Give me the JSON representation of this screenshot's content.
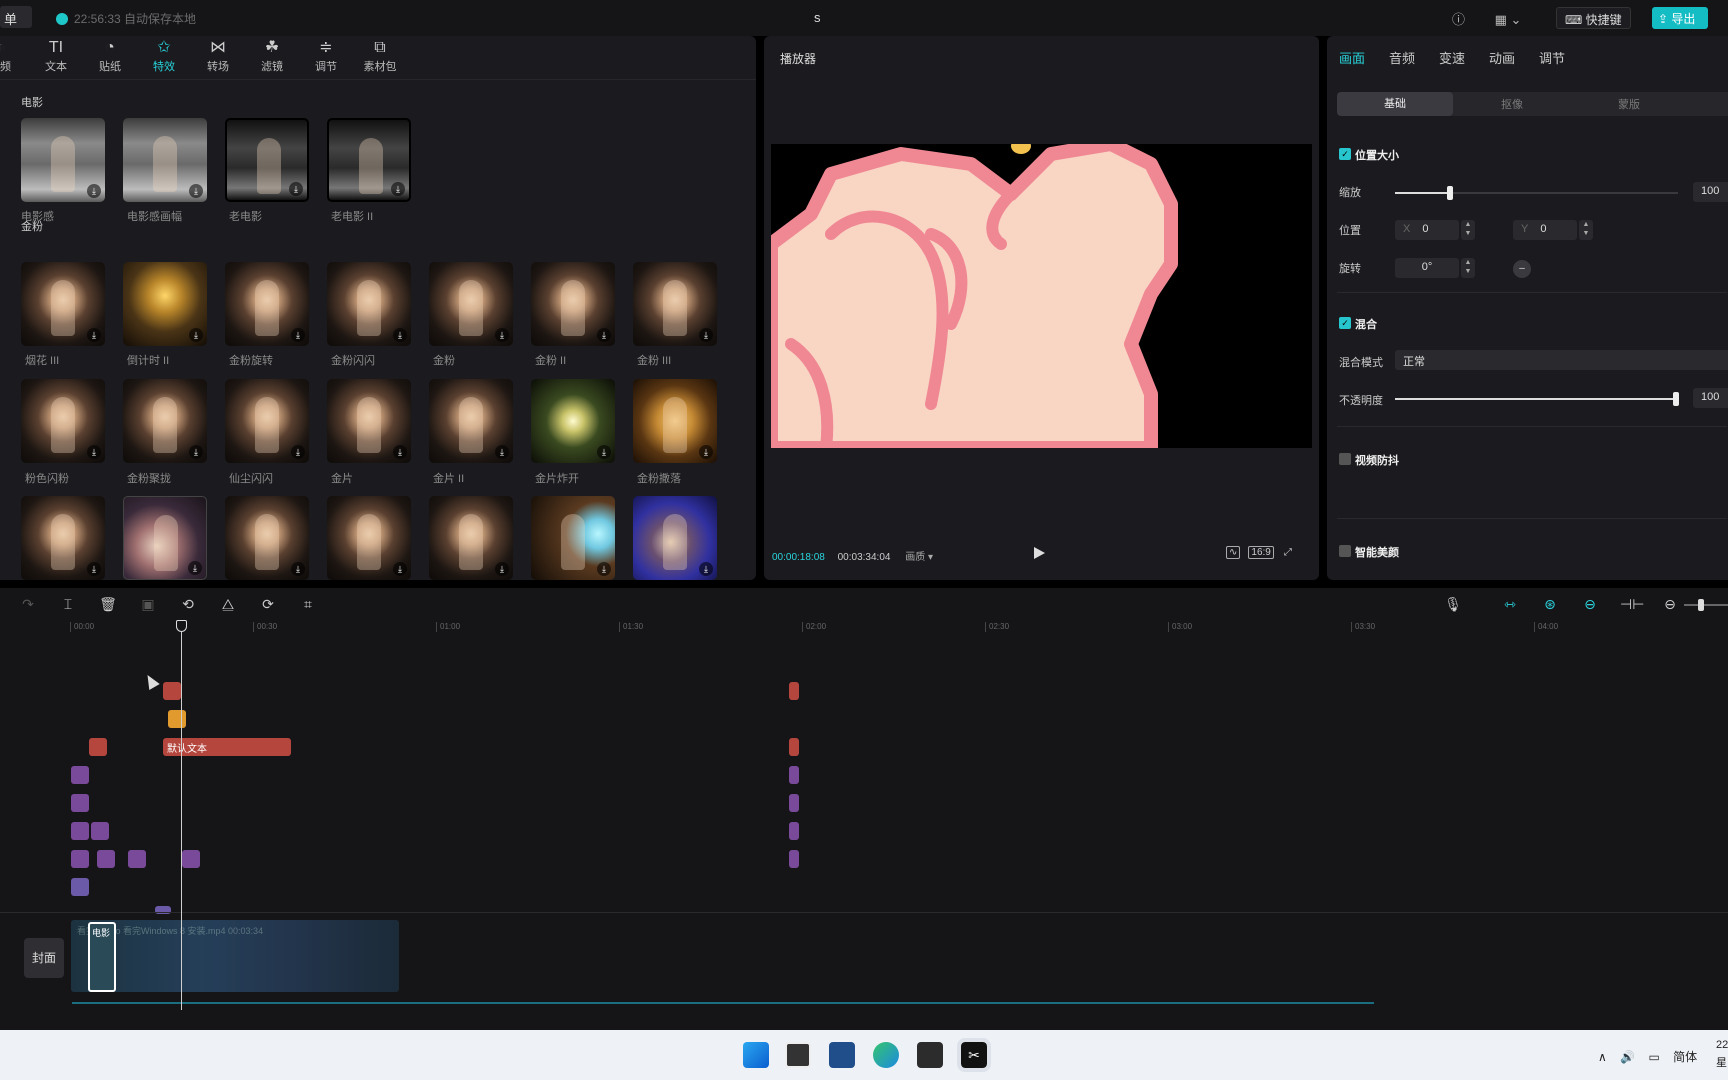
{
  "topbar": {
    "menu_label": "单",
    "save_status": "22:56:33 自动保存本地",
    "project_title": "s",
    "shortcut_label": "快捷键",
    "export_label": "导出"
  },
  "tool_tabs": [
    {
      "label": "视频",
      "icon": "video-icon"
    },
    {
      "label": "文本",
      "icon": "text-icon"
    },
    {
      "label": "贴纸",
      "icon": "sticker-icon"
    },
    {
      "label": "特效",
      "icon": "effects-icon"
    },
    {
      "label": "转场",
      "icon": "transition-icon"
    },
    {
      "label": "滤镜",
      "icon": "filter-icon"
    },
    {
      "label": "调节",
      "icon": "adjust-icon"
    },
    {
      "label": "素材包",
      "icon": "asset-pack-icon"
    }
  ],
  "active_tool_tab": "特效",
  "sections": {
    "film": {
      "title": "电影",
      "items": [
        "电影感",
        "电影感画幅",
        "老电影",
        "老电影 II"
      ]
    },
    "gold": {
      "title": "金粉",
      "row1": [
        "烟花 III",
        "倒计时 II",
        "金粉旋转",
        "金粉闪闪",
        "金粉",
        "金粉 II",
        "金粉 III"
      ],
      "row2": [
        "粉色闪粉",
        "金粉聚拢",
        "仙尘闪闪",
        "金片",
        "金片 II",
        "金片炸开",
        "金粉撒落"
      ]
    }
  },
  "player": {
    "title": "播放器",
    "current_time": "00:00:18:08",
    "total_time": "00:03:34:04",
    "quality_label": "画质",
    "ratio_label": "16:9"
  },
  "props": {
    "tabs": [
      "画面",
      "音频",
      "变速",
      "动画",
      "调节"
    ],
    "subtabs": [
      "基础",
      "抠像",
      "蒙版"
    ],
    "position_size": "位置大小",
    "scale_label": "缩放",
    "scale_value": "100",
    "position_label": "位置",
    "x_prefix": "X",
    "x_value": "0",
    "y_prefix": "Y",
    "y_value": "0",
    "rotate_label": "旋转",
    "rotate_value": "0°",
    "blend_label": "混合",
    "blend_mode_label": "混合模式",
    "blend_mode_value": "正常",
    "opacity_label": "不透明度",
    "opacity_value": "100",
    "stabilize_label": "视频防抖",
    "beauty_label": "智能美颜"
  },
  "timeline": {
    "ruler": [
      "00:00",
      "00:30",
      "01:00",
      "01:30",
      "02:00",
      "02:30",
      "03:00",
      "03:30",
      "04:00"
    ],
    "text_clip": "默认文本",
    "cover_label": "封面",
    "main_clip_label": "电影",
    "main_clip_caption": "看完Windo 看完Windows 8 安装.mp4  00:03:34"
  },
  "taskbar": {
    "tray_lang": "简体",
    "clock_line1": "22",
    "clock_line2": "星"
  }
}
